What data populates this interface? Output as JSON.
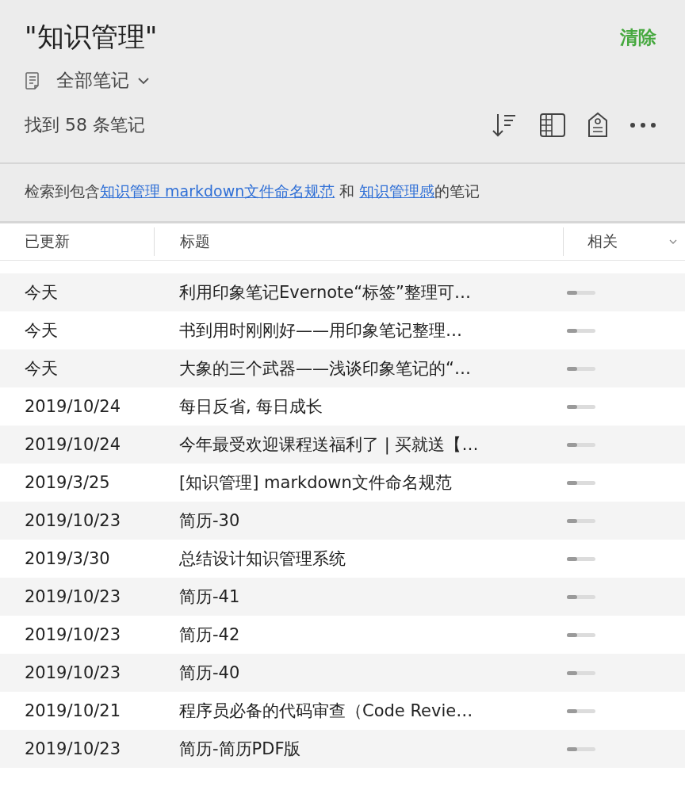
{
  "header": {
    "title": "\"知识管理\"",
    "clear_button": "清除",
    "notebook": "全部笔记",
    "count": "找到 58 条笔记"
  },
  "query_summary": [
    {
      "kind": "text",
      "text": "检索到包含"
    },
    {
      "kind": "link",
      "text": "知识管理 markdown文件命名规范"
    },
    {
      "kind": "text",
      "text": " 和 "
    },
    {
      "kind": "link",
      "text": "知识管理感"
    },
    {
      "kind": "text",
      "text": "的笔记"
    }
  ],
  "table": {
    "columns": [
      "已更新",
      "标题",
      "相关"
    ],
    "rows": [
      {
        "updated": "今天",
        "title": "利用印象笔记Evernote“标签”整理可…",
        "level": 0.35
      },
      {
        "updated": "今天",
        "title": "书到用时刚刚好——用印象笔记整理…",
        "level": 0.35
      },
      {
        "updated": "今天",
        "title": "大象的三个武器——浅谈印象笔记的“…",
        "level": 0.35
      },
      {
        "updated": "2019/10/24",
        "title": "每日反省, 每日成长",
        "level": 0.35
      },
      {
        "updated": "2019/10/24",
        "title": "今年最受欢迎课程送福利了 | 买就送【…",
        "level": 0.35
      },
      {
        "updated": "2019/3/25",
        "title": "[知识管理] markdown文件命名规范",
        "level": 0.35
      },
      {
        "updated": "2019/10/23",
        "title": "简历-30",
        "level": 0.35
      },
      {
        "updated": "2019/3/30",
        "title": "总结设计知识管理系统",
        "level": 0.35
      },
      {
        "updated": "2019/10/23",
        "title": "简历-41",
        "level": 0.35
      },
      {
        "updated": "2019/10/23",
        "title": "简历-42",
        "level": 0.35
      },
      {
        "updated": "2019/10/23",
        "title": "简历-40",
        "level": 0.35
      },
      {
        "updated": "2019/10/21",
        "title": "程序员必备的代码审查（Code Revie…",
        "level": 0.35
      },
      {
        "updated": "2019/10/23",
        "title": "简历-简历PDF版",
        "level": 0.35
      }
    ]
  }
}
